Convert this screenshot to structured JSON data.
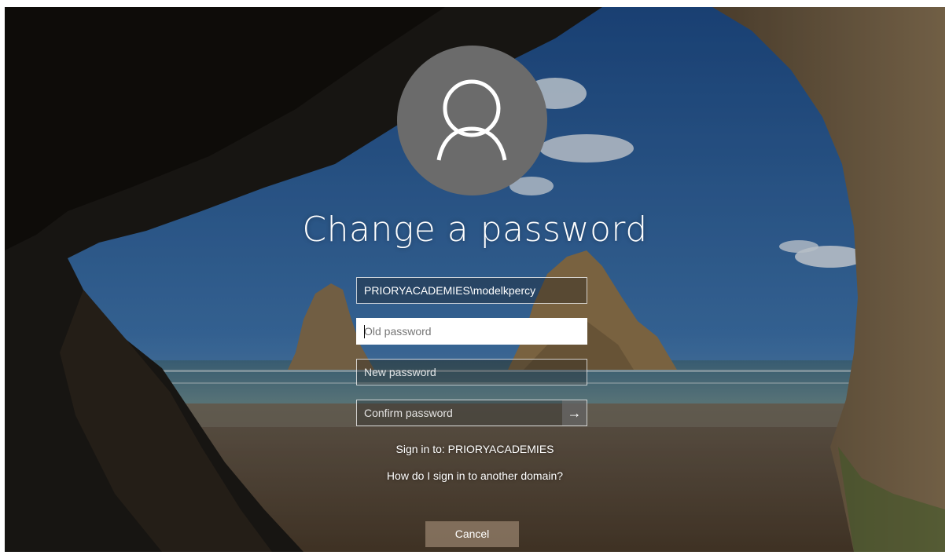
{
  "title": "Change a password",
  "avatar_icon": "user-icon",
  "fields": {
    "username": "PRIORYACADEMIES\\modelkpercy",
    "old_password_placeholder": "Old password",
    "new_password_placeholder": "New password",
    "confirm_password_placeholder": "Confirm password"
  },
  "submit_icon": "arrow-right-icon",
  "submit_glyph": "→",
  "sign_in_to": "Sign in to: PRIORYACADEMIES",
  "help_link": "How do I sign in to another domain?",
  "cancel_label": "Cancel"
}
